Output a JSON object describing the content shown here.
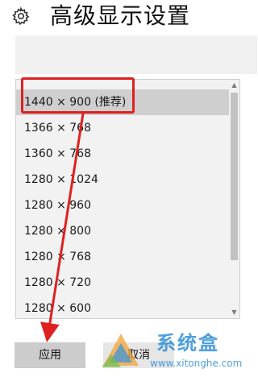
{
  "header": {
    "icon": "gear-icon",
    "title": "高级显示设置"
  },
  "resolution_list": {
    "items": [
      {
        "label": "1440 × 900 (推荐)",
        "selected": true
      },
      {
        "label": "1366 × 768",
        "selected": false
      },
      {
        "label": "1360 × 768",
        "selected": false
      },
      {
        "label": "1280 × 1024",
        "selected": false
      },
      {
        "label": "1280 × 960",
        "selected": false
      },
      {
        "label": "1280 × 800",
        "selected": false
      },
      {
        "label": "1280 × 768",
        "selected": false
      },
      {
        "label": "1280 × 720",
        "selected": false
      },
      {
        "label": "1280 × 600",
        "selected": false
      }
    ]
  },
  "buttons": {
    "apply_label": "应用",
    "cancel_label": "取消"
  },
  "annotation": {
    "color": "#e02020"
  },
  "watermark": {
    "name": "系统盒",
    "url": "www.xitonghe.com",
    "color": "#2f8fd6"
  }
}
